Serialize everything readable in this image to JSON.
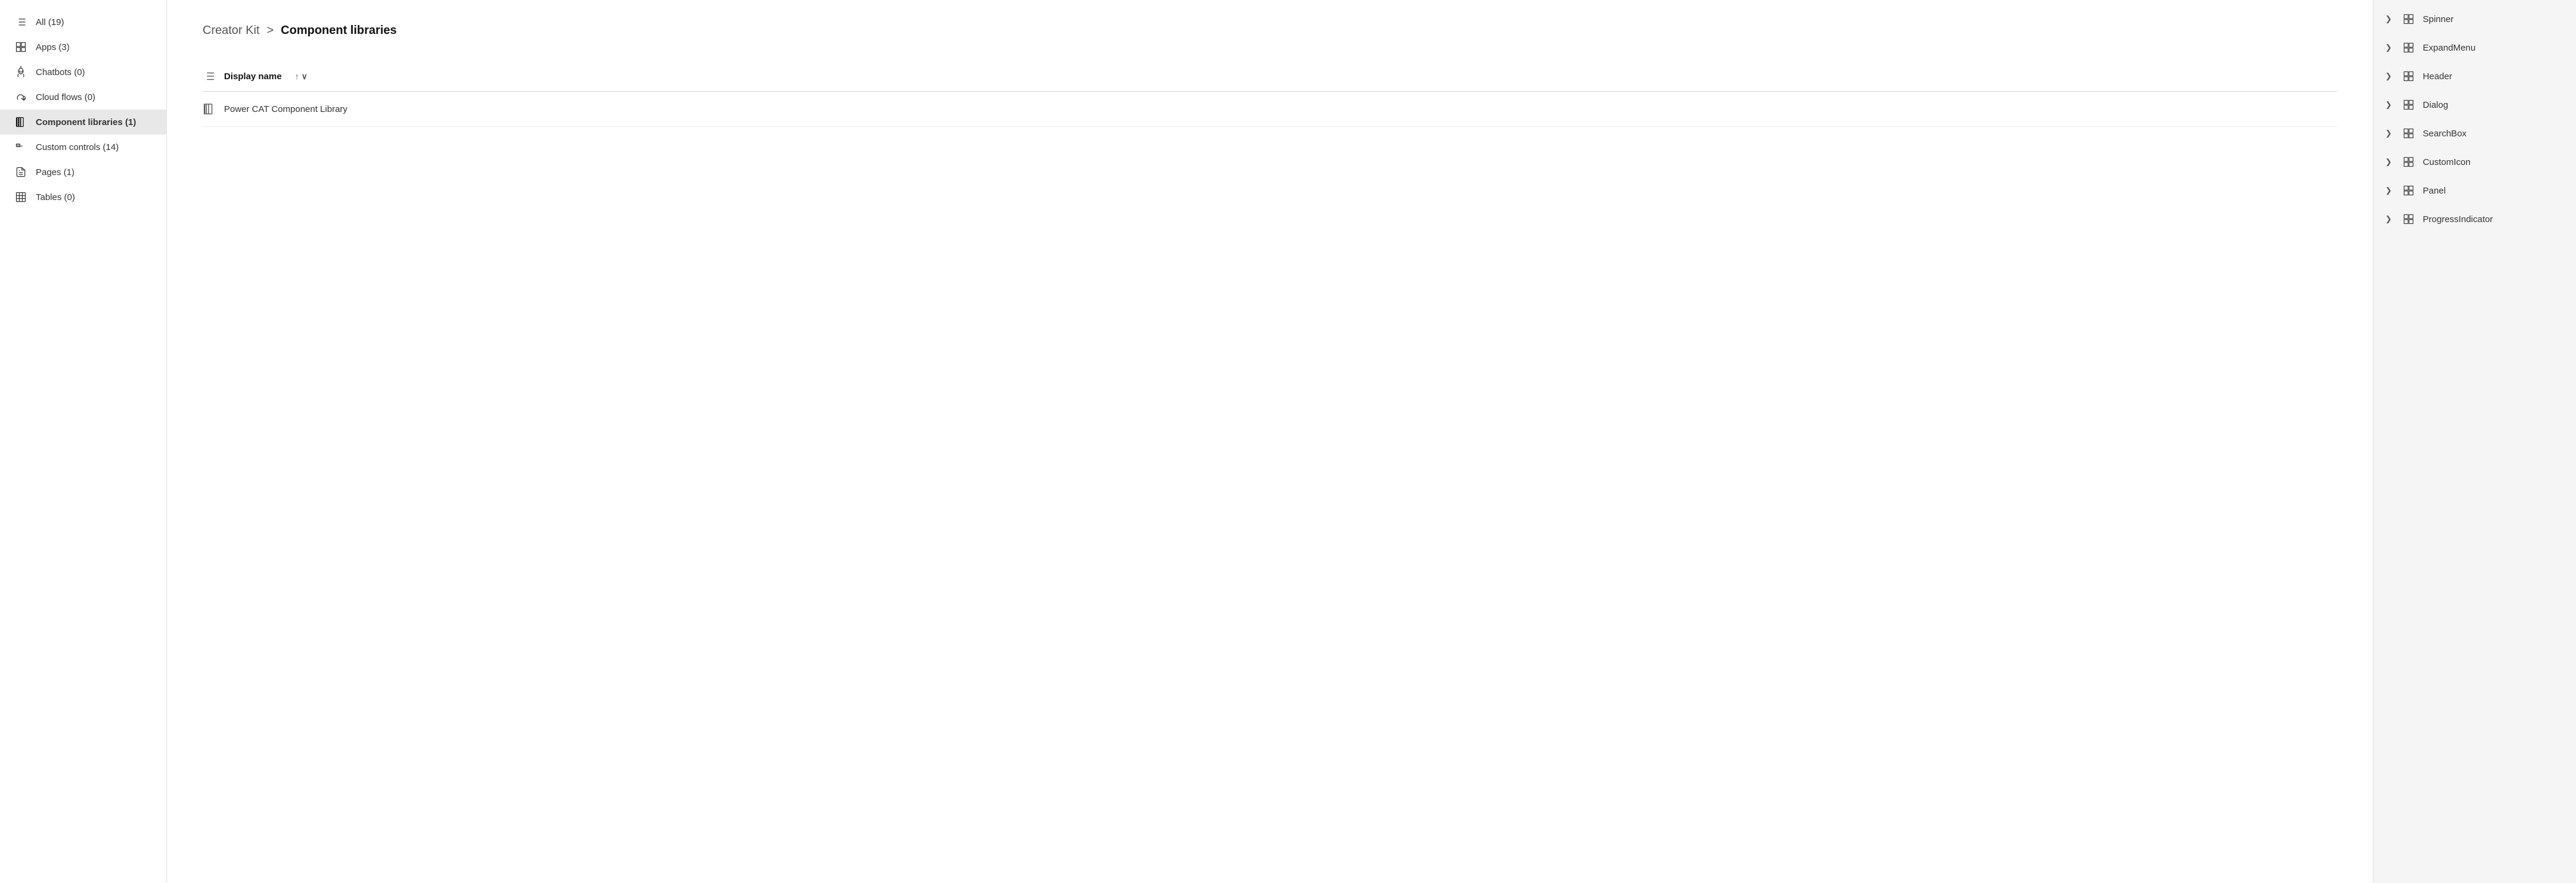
{
  "sidebar": {
    "items": [
      {
        "id": "all",
        "label": "All (19)",
        "icon": "list-icon",
        "active": false
      },
      {
        "id": "apps",
        "label": "Apps (3)",
        "icon": "apps-icon",
        "active": false
      },
      {
        "id": "chatbots",
        "label": "Chatbots (0)",
        "icon": "chatbot-icon",
        "active": false
      },
      {
        "id": "cloud-flows",
        "label": "Cloud flows (0)",
        "icon": "cloud-flow-icon",
        "active": false
      },
      {
        "id": "component-libraries",
        "label": "Component libraries (1)",
        "icon": "component-lib-icon",
        "active": true
      },
      {
        "id": "custom-controls",
        "label": "Custom controls (14)",
        "icon": "custom-controls-icon",
        "active": false
      },
      {
        "id": "pages",
        "label": "Pages (1)",
        "icon": "pages-icon",
        "active": false
      },
      {
        "id": "tables",
        "label": "Tables (0)",
        "icon": "tables-icon",
        "active": false
      }
    ]
  },
  "main": {
    "breadcrumb": {
      "parent": "Creator Kit",
      "separator": ">",
      "current": "Component libraries"
    },
    "table": {
      "column_header": "Display name",
      "sort_asc_label": "↑",
      "sort_desc_label": "∨",
      "rows": [
        {
          "name": "Power CAT Component Library"
        }
      ]
    }
  },
  "right_panel": {
    "items": [
      {
        "label": "Spinner"
      },
      {
        "label": "ExpandMenu"
      },
      {
        "label": "Header"
      },
      {
        "label": "Dialog"
      },
      {
        "label": "SearchBox"
      },
      {
        "label": "CustomIcon"
      },
      {
        "label": "Panel"
      },
      {
        "label": "ProgressIndicator"
      }
    ]
  }
}
